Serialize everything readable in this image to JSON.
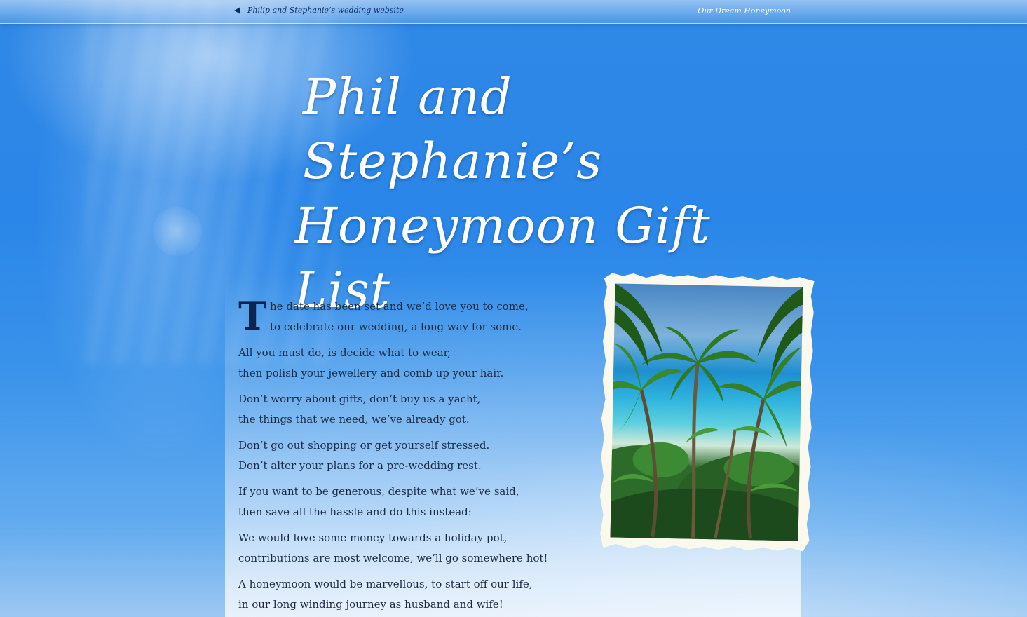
{
  "topbar": {
    "back_label": "Philip and Stephanie’s wedding website",
    "nav_right_label": "Our Dream Honeymoon"
  },
  "title": {
    "line1": "Phil and Stephanie’s",
    "line2": "Honeymoon Gift List"
  },
  "poem": {
    "dropcap": "T",
    "stanzas": [
      {
        "line1": "he date has been set and we’d love you to come,",
        "line2": "to celebrate our wedding, a long way for some."
      },
      {
        "line1": "All you must do, is decide what to wear,",
        "line2": "then polish your jewellery and comb up your hair."
      },
      {
        "line1": "Don’t worry about gifts, don’t buy us a yacht,",
        "line2": "the things that we need, we’ve already got."
      },
      {
        "line1": "Don’t go out shopping or get yourself stressed.",
        "line2": "Don’t alter your plans for a pre-wedding rest."
      },
      {
        "line1": "If you want to be generous, despite what we’ve said,",
        "line2": "then save all the hassle and do this instead:"
      },
      {
        "line1": "We would love some money towards a holiday pot,",
        "line2": "contributions are most welcome, we’ll go somewhere hot!"
      },
      {
        "line1": "A honeymoon would be marvellous, to start off our life,",
        "line2": "in our long winding journey as husband and wife!"
      }
    ]
  },
  "colors": {
    "sky": "#2a86e8",
    "text": "#1c2a44",
    "dropcap": "#0e2450",
    "frame": "#fbf8ee"
  },
  "icons": {
    "back": "back-arrow-icon"
  }
}
